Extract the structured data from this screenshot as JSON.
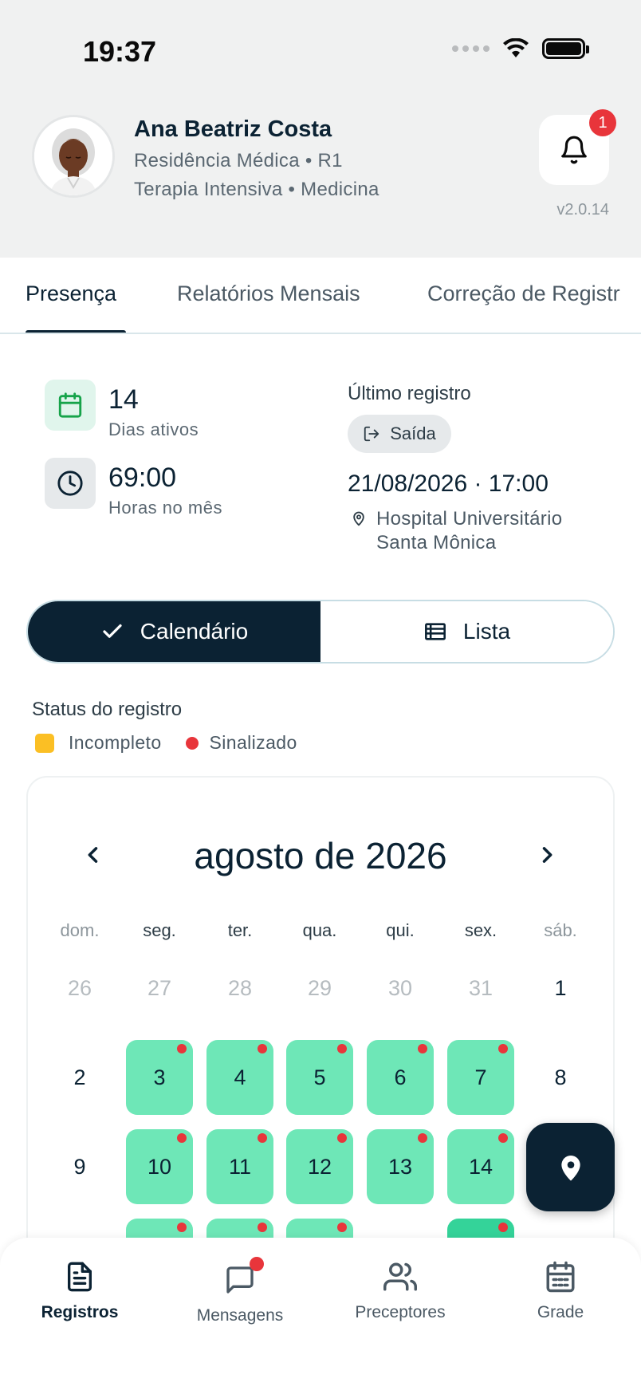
{
  "status_bar": {
    "time": "19:37"
  },
  "profile": {
    "name": "Ana Beatriz Costa",
    "line1": "Residência Médica • R1",
    "line2": "Terapia Intensiva • Medicina",
    "notifications_count": "1",
    "version": "v2.0.14"
  },
  "tabs": [
    {
      "label": "Presença",
      "active": true
    },
    {
      "label": "Relatórios Mensais",
      "active": false
    },
    {
      "label": "Correção de Registr",
      "active": false
    }
  ],
  "stats": {
    "active_days": {
      "value": "14",
      "label": "Dias ativos",
      "icon": "calendar-icon"
    },
    "hours": {
      "value": "69:00",
      "label": "Horas no mês",
      "icon": "clock-icon"
    }
  },
  "last_record": {
    "title": "Último registro",
    "type_label": "Saída",
    "datetime": "21/08/2026 · 17:00",
    "location": "Hospital Universitário\nSanta Mônica"
  },
  "view_toggle": {
    "calendar_label": "Calendário",
    "list_label": "Lista",
    "selected": "calendar"
  },
  "legend": {
    "title": "Status do registro",
    "incomplete": "Incompleto",
    "flagged": "Sinalizado"
  },
  "calendar": {
    "month_title": "agosto de 2026",
    "weekdays": [
      "dom.",
      "seg.",
      "ter.",
      "qua.",
      "qui.",
      "sex.",
      "sáb."
    ],
    "weeks": [
      [
        {
          "d": "26",
          "muted": true
        },
        {
          "d": "27",
          "muted": true
        },
        {
          "d": "28",
          "muted": true
        },
        {
          "d": "29",
          "muted": true
        },
        {
          "d": "30",
          "muted": true
        },
        {
          "d": "31",
          "muted": true
        },
        {
          "d": "1"
        }
      ],
      [
        {
          "d": "2"
        },
        {
          "d": "3",
          "active": true,
          "flag": true
        },
        {
          "d": "4",
          "active": true,
          "flag": true
        },
        {
          "d": "5",
          "active": true,
          "flag": true
        },
        {
          "d": "6",
          "active": true,
          "flag": true
        },
        {
          "d": "7",
          "active": true,
          "flag": true
        },
        {
          "d": "8"
        }
      ],
      [
        {
          "d": "9"
        },
        {
          "d": "10",
          "active": true,
          "flag": true
        },
        {
          "d": "11",
          "active": true,
          "flag": true
        },
        {
          "d": "12",
          "active": true,
          "flag": true
        },
        {
          "d": "13",
          "active": true,
          "flag": true
        },
        {
          "d": "14",
          "active": true,
          "flag": true
        },
        {
          "d": ""
        }
      ],
      [
        {
          "d": ""
        },
        {
          "d": "",
          "active": true,
          "flag": true
        },
        {
          "d": "",
          "active": true,
          "flag": true
        },
        {
          "d": "",
          "active": true,
          "flag": true
        },
        {
          "d": ""
        },
        {
          "d": "",
          "active": true,
          "strong": true,
          "flag": true
        },
        {
          "d": ""
        }
      ]
    ]
  },
  "bottom_nav": [
    {
      "label": "Registros",
      "icon": "document-icon",
      "active": true
    },
    {
      "label": "Mensagens",
      "icon": "message-icon",
      "active": false,
      "dot": true
    },
    {
      "label": "Preceptores",
      "icon": "users-icon",
      "active": false
    },
    {
      "label": "Grade",
      "icon": "calendar-grid-icon",
      "active": false
    }
  ],
  "colors": {
    "primary": "#0b2233",
    "active_day": "#6ee7b7",
    "active_day_strong": "#34d399",
    "flag": "#e8353b",
    "incomplete": "#fbbf24"
  }
}
